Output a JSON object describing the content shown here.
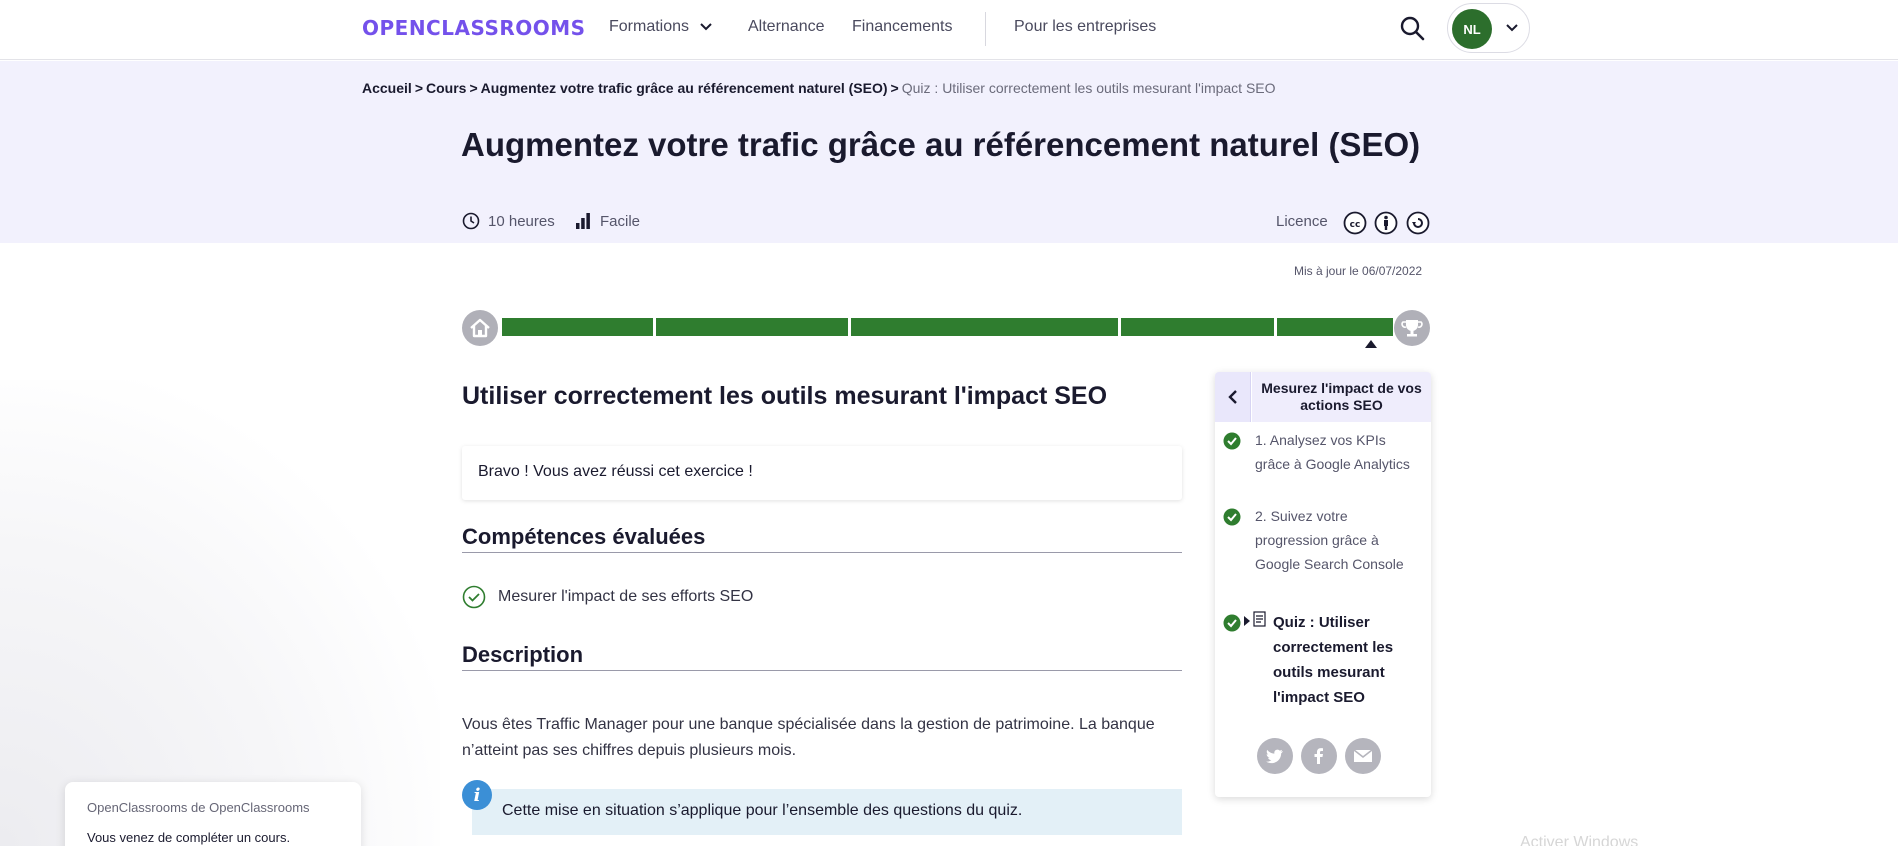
{
  "header": {
    "logo": "OPENCLASSROOMS",
    "nav": [
      {
        "label": "Formations"
      },
      {
        "label": "Alternance"
      },
      {
        "label": "Financements"
      },
      {
        "label": "Pour les entreprises"
      }
    ],
    "user_initials": "NL"
  },
  "breadcrumb": {
    "items": [
      "Accueil",
      "Cours",
      "Augmentez votre trafic grâce au référencement naturel (SEO)"
    ],
    "separator": ">",
    "current": "Quiz : Utiliser correctement les outils mesurant l'impact SEO"
  },
  "course": {
    "title": "Augmentez votre trafic grâce au référencement naturel (SEO)",
    "duration": "10 heures",
    "level": "Facile",
    "licence_label": "Licence",
    "updated": "Mis à jour le 06/07/2022"
  },
  "progress": {
    "fraction_complete": 1.0,
    "completed_color": "#2f7d2f"
  },
  "main": {
    "chapter_title": "Utiliser correctement les outils mesurant l'impact SEO",
    "success_message": "Bravo ! Vous avez réussi cet exercice !",
    "skills_heading": "Compétences évaluées",
    "skills": [
      "Mesurer l'impact de ses efforts SEO"
    ],
    "description_heading": "Description",
    "description": "Vous êtes Traffic Manager pour une banque spécialisée dans la gestion de patrimoine. La banque n’atteint pas ses chiffres depuis plusieurs mois.",
    "info": "Cette mise en situation s’applique pour l’ensemble des questions du quiz."
  },
  "sidebar": {
    "title": "Mesurez l'impact de vos actions SEO",
    "items": [
      {
        "label": "1. Analysez vos KPIs grâce à Google Analytics"
      },
      {
        "label": "2. Suivez votre progression grâce à Google Search Console"
      },
      {
        "label": "Quiz : Utiliser correctement les outils mesurant l'impact SEO"
      }
    ]
  },
  "toast": {
    "source": "OpenClassrooms de OpenClassrooms",
    "message": "Vous venez de compléter un cours."
  },
  "watermark": "Activer Windows",
  "colors": {
    "brand": "#7451eb",
    "success": "#2f7d2f",
    "hero_bg": "#f2f1fd",
    "info_bg": "#e3f0f7"
  }
}
